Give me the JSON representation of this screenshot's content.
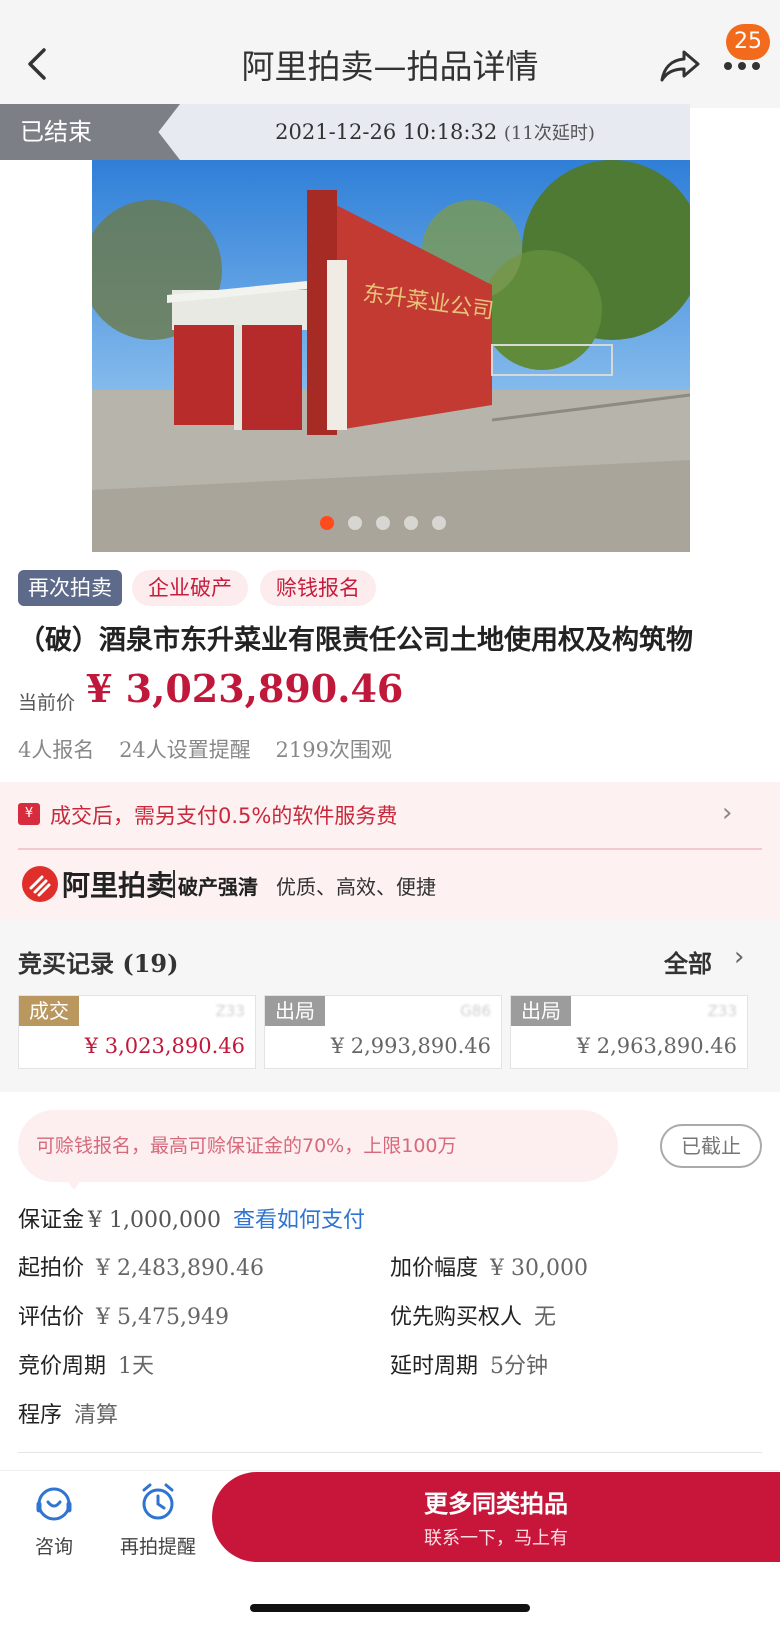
{
  "header": {
    "title": "阿里拍卖—拍品详情",
    "badge_count": "25"
  },
  "status": {
    "label": "已结束",
    "time": "2021-12-26 10:18:32",
    "extension": "(11次延时)"
  },
  "gallery": {
    "image_count": 5,
    "active_index": 0
  },
  "tags": [
    "再次拍卖",
    "企业破产",
    "赊钱报名"
  ],
  "lot": {
    "title": "（破）酒泉市东升菜业有限责任公司土地使用权及构筑物",
    "price_label": "当前价",
    "price": "¥ 3,023,890.46",
    "stats": [
      "4人报名",
      "24人设置提醒",
      "2199次围观"
    ]
  },
  "promo": {
    "fee_icon": "¥",
    "fee_text": "成交后，需另支付0.5%的软件服务费",
    "logo_text": "阿里拍卖",
    "logo_sub": "破产强清",
    "logo_sub2": "优质、高效、便捷"
  },
  "bids": {
    "title": "竞买记录",
    "count": "(19)",
    "all_label": "全部",
    "records": [
      {
        "status": "成交",
        "user": "Z33",
        "amount": "¥ 3,023,890.46"
      },
      {
        "status": "出局",
        "user": "G86",
        "amount": "¥ 2,993,890.46"
      },
      {
        "status": "出局",
        "user": "Z33",
        "amount": "¥ 2,963,890.46"
      }
    ]
  },
  "deposit": {
    "bubble_text": "可赊钱报名，最高可赊保证金的70%，上限100万",
    "closed_label": "已截止",
    "label": "保证金",
    "value": "¥ 1,000,000",
    "link": "查看如何支付"
  },
  "details": {
    "start_price": {
      "label": "起拍价",
      "value": "¥ 2,483,890.46"
    },
    "increment": {
      "label": "加价幅度",
      "value": "¥ 30,000"
    },
    "appraisal": {
      "label": "评估价",
      "value": "¥ 5,475,949"
    },
    "priority": {
      "label": "优先购买权人",
      "value": "无"
    },
    "cycle": {
      "label": "竞价周期",
      "value": "1天"
    },
    "delay": {
      "label": "延时周期",
      "value": "5分钟"
    },
    "procedure": {
      "label": "程序",
      "value": "清算"
    }
  },
  "bottom": {
    "consult": "咨询",
    "remind": "再拍提醒",
    "cta_main": "更多同类拍品",
    "cta_sub": "联系一下，马上有"
  }
}
